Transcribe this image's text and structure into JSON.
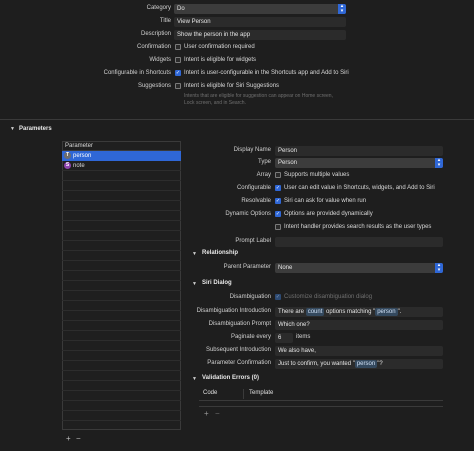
{
  "intent": {
    "category_label": "Category",
    "category_value": "Do",
    "title_label": "Title",
    "title_value": "View Person",
    "description_label": "Description",
    "description_value": "Show the person in the app",
    "confirmation_label": "Confirmation",
    "confirmation_text": "User confirmation required",
    "widgets_label": "Widgets",
    "widgets_text": "Intent is eligible for widgets",
    "shortcuts_label": "Configurable in Shortcuts",
    "shortcuts_text": "Intent is user-configurable in the Shortcuts app and Add to Siri",
    "suggestions_label": "Suggestions",
    "suggestions_text": "Intent is eligible for Siri Suggestions",
    "suggestions_hint_1": "Intents that are eligible for suggestion can appear on Home screen,",
    "suggestions_hint_2": "Lock screen, and in Search."
  },
  "parameters_section": {
    "title": "Parameters",
    "list_header": "Parameter",
    "items": [
      {
        "name": "person",
        "icon_letter": "T",
        "icon_color": "#6e6e6e"
      },
      {
        "name": "note",
        "icon_letter": "S",
        "icon_color": "#8e44ad"
      }
    ],
    "add_label": "+",
    "remove_label": "−"
  },
  "parameter_detail": {
    "display_name_label": "Display Name",
    "display_name_value": "Person",
    "type_label": "Type",
    "type_value": "Person",
    "array_label": "Array",
    "array_text": "Supports multiple values",
    "configurable_label": "Configurable",
    "configurable_text": "User can edit value in Shortcuts, widgets, and Add to Siri",
    "resolvable_label": "Resolvable",
    "resolvable_text": "Siri can ask for value when run",
    "dynamic_label": "Dynamic Options",
    "dynamic_text": "Options are provided dynamically",
    "search_text": "Intent handler provides search results as the user types",
    "prompt_label": "Prompt Label",
    "prompt_value": ""
  },
  "relationship": {
    "title": "Relationship",
    "parent_label": "Parent Parameter",
    "parent_value": "None"
  },
  "siri_dialog": {
    "title": "Siri Dialog",
    "disambiguation_label": "Disambiguation",
    "disambiguation_text": "Customize disambiguation dialog",
    "intro_label": "Disambiguation Introduction",
    "intro_prefix": "There are",
    "intro_token_1": "count",
    "intro_mid": "options matching \"",
    "intro_token_2": "person",
    "intro_suffix": "\".",
    "prompt_label": "Disambiguation Prompt",
    "prompt_value": "Which one?",
    "paginate_label": "Paginate every",
    "paginate_value": "6",
    "paginate_unit": "items",
    "subsequent_label": "Subsequent Introduction",
    "subsequent_value": "We also have,",
    "confirmation_label": "Parameter Confirmation",
    "confirmation_prefix": "Just to confirm, you wanted \"",
    "confirmation_token": "person",
    "confirmation_suffix": "\"?"
  },
  "validation": {
    "title": "Validation Errors (0)",
    "col_code": "Code",
    "col_template": "Template",
    "add_label": "+",
    "remove_label": "−"
  }
}
